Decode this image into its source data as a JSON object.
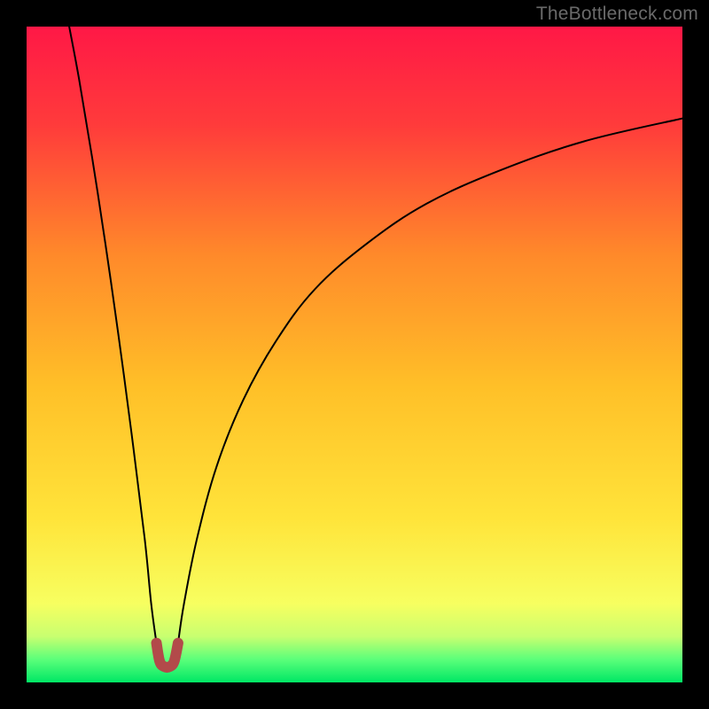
{
  "watermark": "TheBottleneck.com",
  "chart_data": {
    "type": "line",
    "title": "",
    "xlabel": "",
    "ylabel": "",
    "xlim": [
      0,
      100
    ],
    "ylim": [
      0,
      100
    ],
    "grid": false,
    "legend": false,
    "background": {
      "description": "vertical gradient from red (top) through orange/yellow to green (bottom); green band occupies bottom ~5%",
      "stops": [
        {
          "pos": 0.0,
          "color": "#ff1846"
        },
        {
          "pos": 0.15,
          "color": "#ff3b3b"
        },
        {
          "pos": 0.35,
          "color": "#ff8a2a"
        },
        {
          "pos": 0.55,
          "color": "#ffc028"
        },
        {
          "pos": 0.75,
          "color": "#ffe43a"
        },
        {
          "pos": 0.88,
          "color": "#f7ff60"
        },
        {
          "pos": 0.93,
          "color": "#c8ff70"
        },
        {
          "pos": 0.965,
          "color": "#5bff7a"
        },
        {
          "pos": 1.0,
          "color": "#00e765"
        }
      ]
    },
    "series": [
      {
        "name": "bottleneck-curve-left",
        "description": "steep descending branch from top-left down to the minimum near x≈20",
        "points": [
          {
            "x": 6.5,
            "y": 100
          },
          {
            "x": 8,
            "y": 92
          },
          {
            "x": 10,
            "y": 80
          },
          {
            "x": 12,
            "y": 67
          },
          {
            "x": 14,
            "y": 53
          },
          {
            "x": 16,
            "y": 38
          },
          {
            "x": 18,
            "y": 22
          },
          {
            "x": 19,
            "y": 12
          },
          {
            "x": 19.8,
            "y": 6
          }
        ]
      },
      {
        "name": "bottleneck-curve-min",
        "description": "small U-shaped notch at the bottom (thick dark-red marker)",
        "points": [
          {
            "x": 19.8,
            "y": 6
          },
          {
            "x": 20.3,
            "y": 3.2
          },
          {
            "x": 21.0,
            "y": 2.4
          },
          {
            "x": 21.8,
            "y": 2.4
          },
          {
            "x": 22.5,
            "y": 3.2
          },
          {
            "x": 23.1,
            "y": 6
          }
        ]
      },
      {
        "name": "bottleneck-curve-right",
        "description": "ascending branch curving from the minimum toward upper-right",
        "points": [
          {
            "x": 23.1,
            "y": 6
          },
          {
            "x": 24,
            "y": 12
          },
          {
            "x": 26,
            "y": 22
          },
          {
            "x": 29,
            "y": 33
          },
          {
            "x": 33,
            "y": 43
          },
          {
            "x": 38,
            "y": 52
          },
          {
            "x": 44,
            "y": 60
          },
          {
            "x": 52,
            "y": 67
          },
          {
            "x": 61,
            "y": 73
          },
          {
            "x": 72,
            "y": 78
          },
          {
            "x": 85,
            "y": 82.5
          },
          {
            "x": 100,
            "y": 86
          }
        ]
      }
    ]
  }
}
